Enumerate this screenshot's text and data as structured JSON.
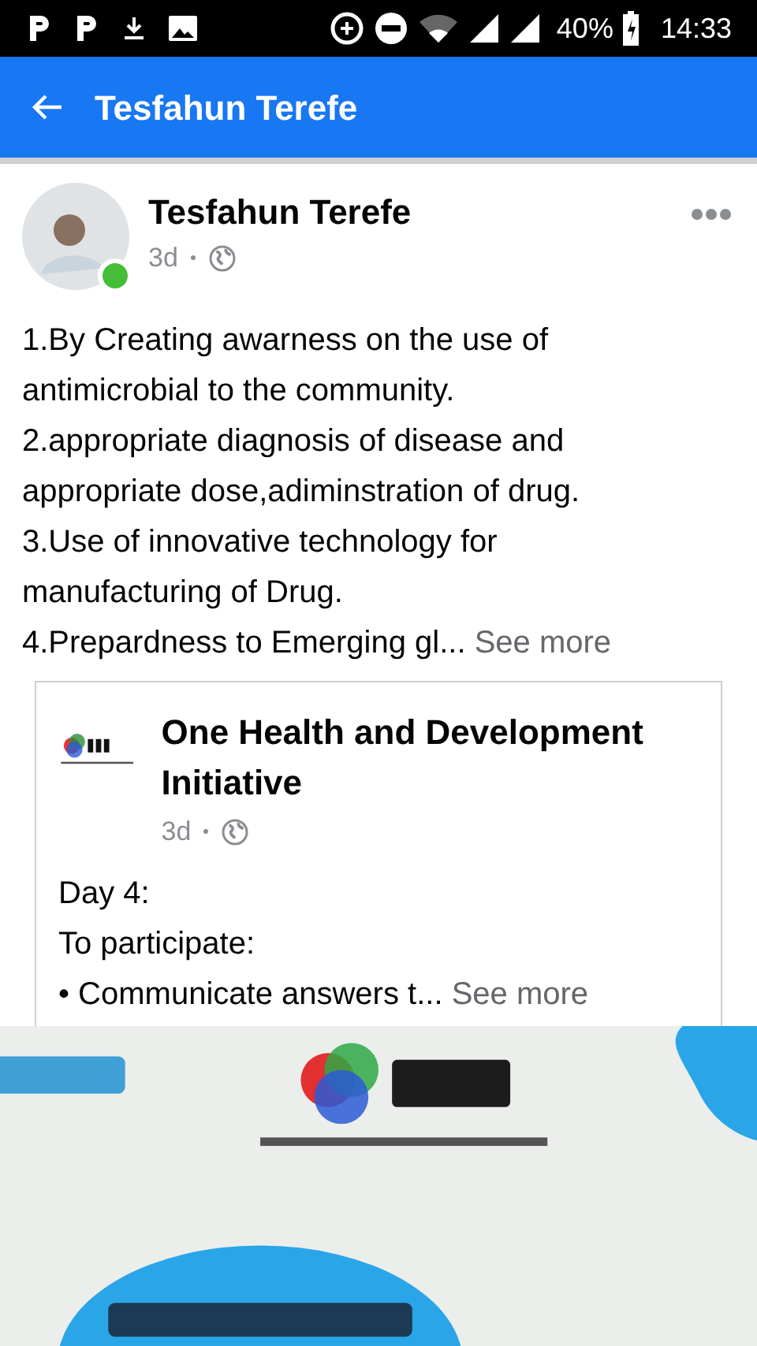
{
  "status_bar": {
    "battery": "40%",
    "time": "14:33"
  },
  "app_bar": {
    "title": "Tesfahun Terefe"
  },
  "post": {
    "author": "Tesfahun Terefe",
    "online": true,
    "time": "3d",
    "lines": [
      "1.By Creating awarness on the use of",
      "antimicrobial to the community.",
      "2.appropriate diagnosis of disease and",
      "appropriate dose,adiminstration of drug.",
      "3.Use of innovative technology for",
      "manufacturing of Drug.",
      "4.Prepardness to Emerging gl..."
    ],
    "see_more": "See more",
    "shared": {
      "author": "One Health and Development Initiative",
      "time": "3d",
      "lines": [
        "Day 4:",
        "To participate:",
        "• Communicate answers t..."
      ],
      "see_more": "See more"
    }
  }
}
